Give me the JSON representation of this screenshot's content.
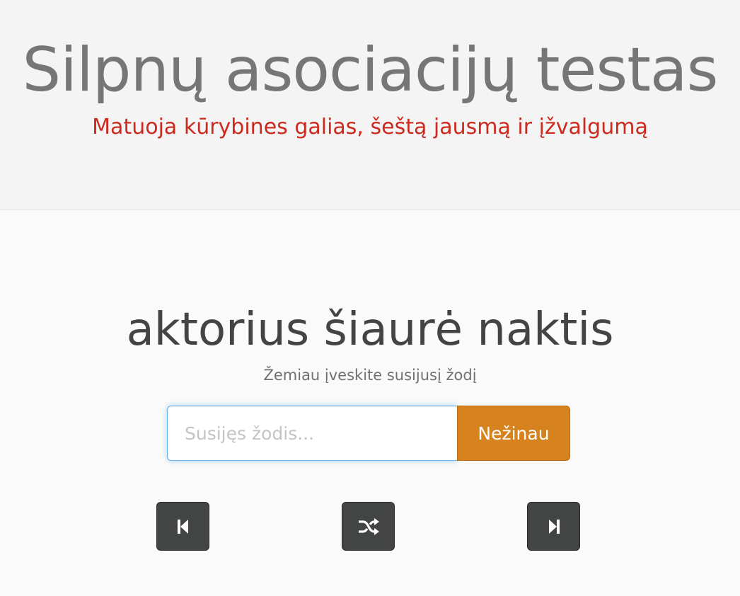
{
  "header": {
    "title": "Silpnų asociacijų testas",
    "subtitle": "Matuoja kūrybines galias, šeštą jausmą ir įžvalgumą"
  },
  "puzzle": {
    "words": "aktorius šiaurė naktis",
    "hint": "Žemiau įveskite susijusį žodį"
  },
  "answer": {
    "placeholder": "Susijęs žodis...",
    "value": "",
    "dont_know_label": "Nežinau"
  },
  "navigation": {
    "previous_icon": "skip-previous-icon",
    "shuffle_icon": "shuffle-icon",
    "next_icon": "skip-next-icon"
  },
  "colors": {
    "header_background": "#f4f4f4",
    "title": "#767676",
    "subtitle": "#cc2a1e",
    "accent_button": "#d6821e",
    "nav_button": "#434444",
    "input_focus_border": "#66afe9"
  }
}
